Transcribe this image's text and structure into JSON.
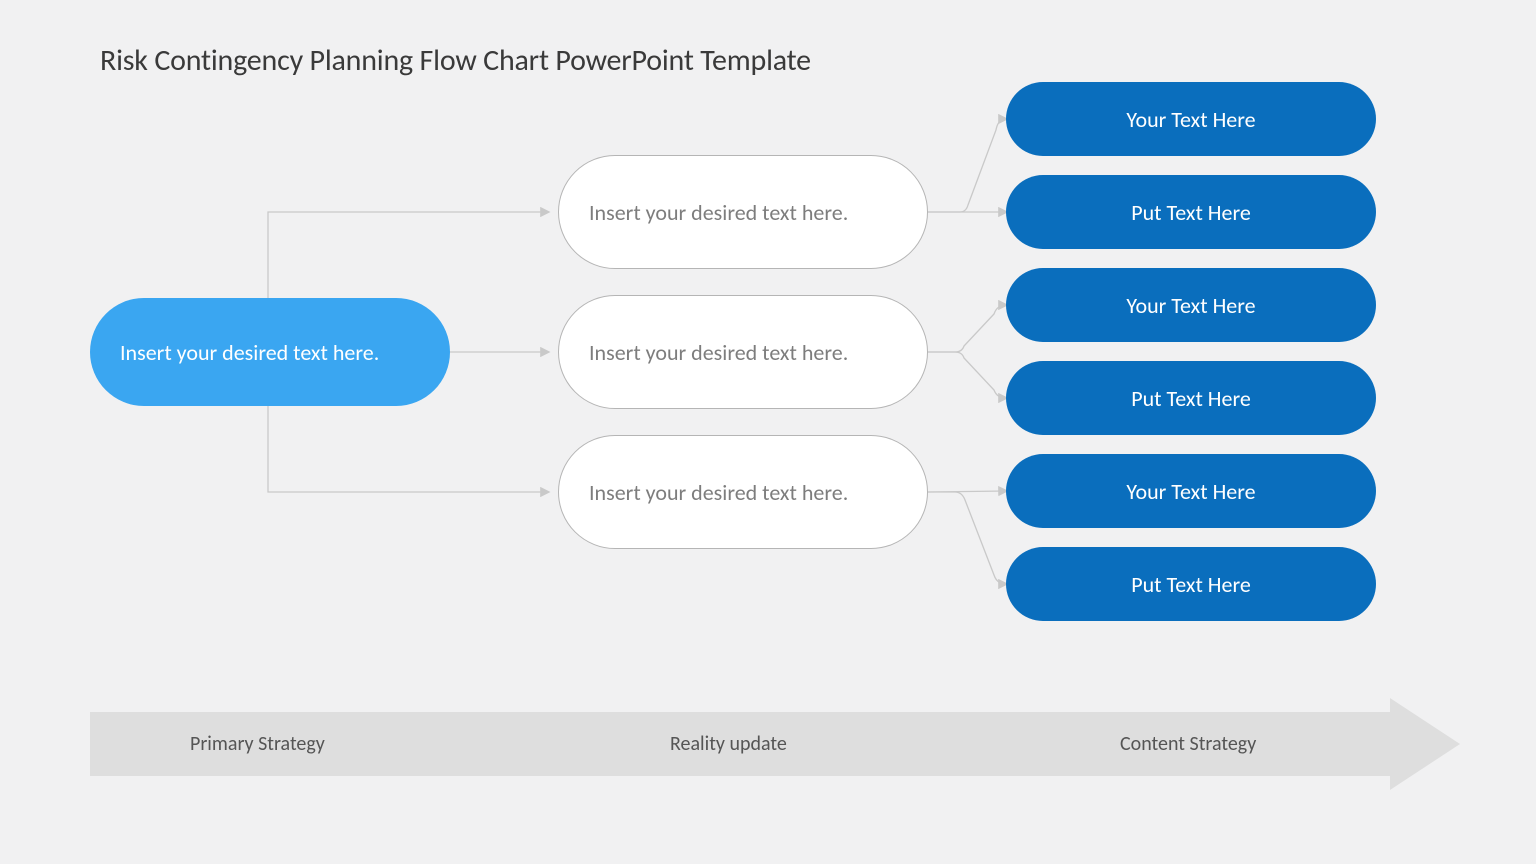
{
  "title": "Risk Contingency Planning Flow Chart PowerPoint Template",
  "root": {
    "text": "Insert your desired text here."
  },
  "mids": [
    {
      "text": "Insert your desired text here."
    },
    {
      "text": "Insert your desired text here."
    },
    {
      "text": "Insert your desired text here."
    }
  ],
  "leaves": [
    {
      "text": "Your Text Here"
    },
    {
      "text": "Put Text Here"
    },
    {
      "text": "Your Text Here"
    },
    {
      "text": "Put Text Here"
    },
    {
      "text": "Your Text Here"
    },
    {
      "text": "Put Text Here"
    }
  ],
  "axis": {
    "label1": "Primary Strategy",
    "label2": "Reality update",
    "label3": "Content Strategy"
  },
  "colors": {
    "root_fill": "#3aa6f1",
    "leaf_fill": "#0a6ebd",
    "background": "#f1f1f2",
    "connector": "#c9c9c9",
    "arrow_fill": "#dedede"
  },
  "chart_data": {
    "type": "tree",
    "levels": [
      {
        "name": "Primary Strategy",
        "nodes": 1
      },
      {
        "name": "Reality update",
        "nodes": 3
      },
      {
        "name": "Content Strategy",
        "nodes": 6
      }
    ],
    "edges": [
      [
        0,
        0,
        1,
        0
      ],
      [
        0,
        0,
        1,
        1
      ],
      [
        0,
        0,
        1,
        2
      ],
      [
        1,
        0,
        2,
        0
      ],
      [
        1,
        0,
        2,
        1
      ],
      [
        1,
        1,
        2,
        2
      ],
      [
        1,
        1,
        2,
        3
      ],
      [
        1,
        2,
        2,
        4
      ],
      [
        1,
        2,
        2,
        5
      ]
    ]
  }
}
